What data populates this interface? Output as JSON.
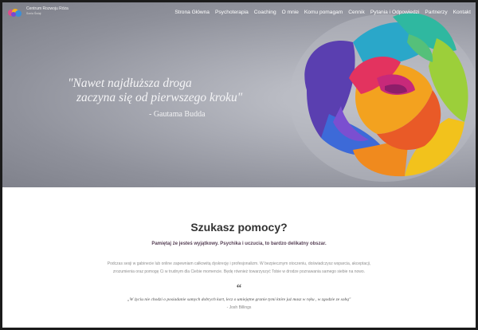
{
  "brand": {
    "name": "Centrum Rozwoju Róża",
    "tagline": "Sonia Świąt"
  },
  "nav": {
    "items": [
      "Strona Główna",
      "Psychoterapia",
      "Coaching",
      "O mnie",
      "Komu pomagam",
      "Cennik",
      "Pytania i Odpowiedzi",
      "Partnerzy",
      "Kontakt"
    ]
  },
  "hero": {
    "quote_line1": "\"Nawet najdłuższa droga",
    "quote_line2": "zaczyna się od pierwszego kroku\"",
    "author": "- Gautama Budda"
  },
  "section": {
    "title": "Szukasz pomocy?",
    "lead": "Pamiętaj że jesteś wyjątkowy. Psychika i uczucia, to bardzo delikatny obszar.",
    "body_line1": "Podczas sesji w gabinecie lub online zapewniam całkowitą dyskrecję i profesjonalizm. W bezpiecznym otoczeniu, doświadczysz wsparcia, akceptacji,",
    "body_line2": "zrozumienia oraz pomogę Ci w trudnym dla Ciebie momencie. Będę również towarzyszyć Tobie w drodze poznawania samego siebie na nowo.",
    "quote_mark": "“",
    "testimonial": "„W życiu nie chodzi o posiadanie samych dobrych kart, lecz o umiejętne granie tymi które już masz w ręku , w zgodzie ze sobą\"",
    "testimonial_author": "- Josh Billings"
  },
  "colors": {
    "heading": "#333333",
    "lead": "#574156",
    "body": "#8e8e8e",
    "hero_bg": "#9a9ca5"
  }
}
